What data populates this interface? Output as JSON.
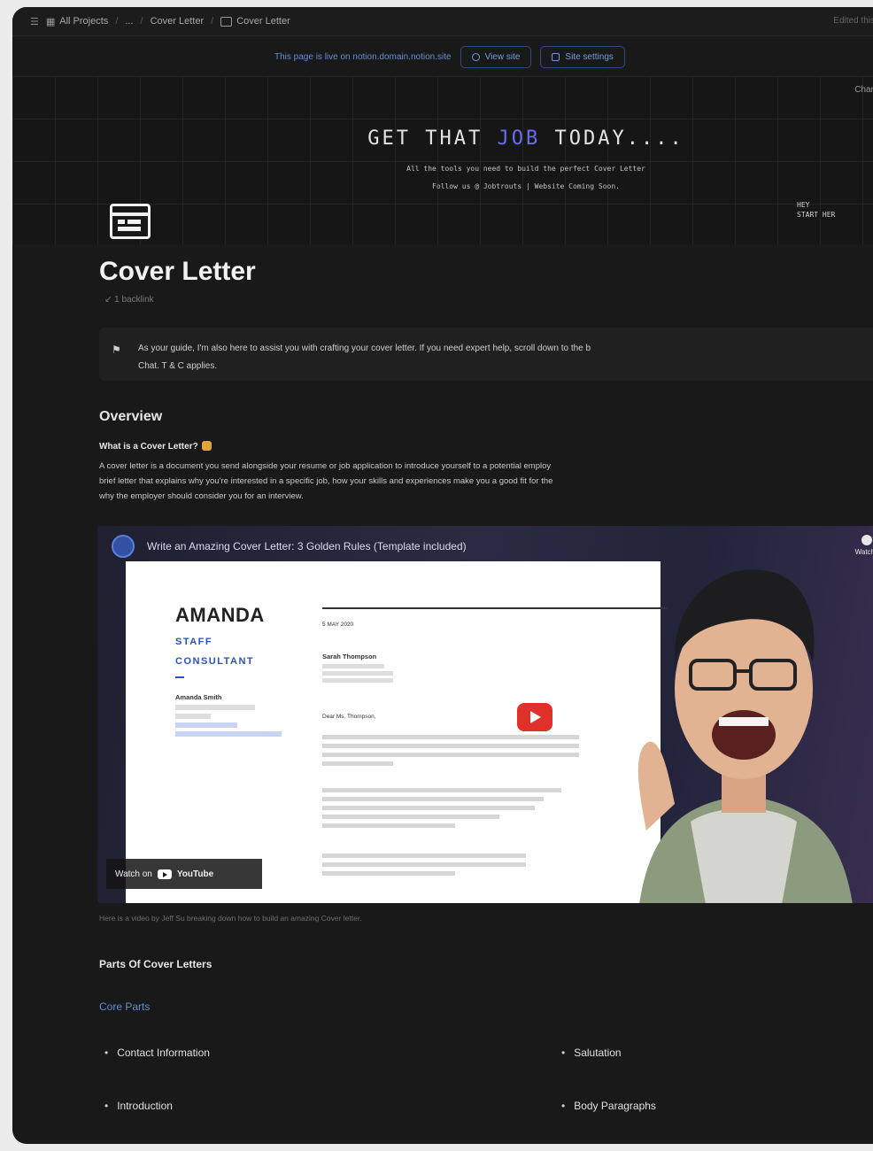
{
  "breadcrumbs": [
    "All Projects",
    "...",
    "Cover Letter",
    "Cover Letter"
  ],
  "edit_info": "Edited this w",
  "banner": {
    "note": "This page is live on notion.domain.notion.site",
    "view_site": "View site",
    "site_settings": "Site settings"
  },
  "cover": {
    "change_cover": "Change c",
    "headline_pre": "GET THAT ",
    "headline_highlight": "JOB",
    "headline_post": " TODAY....",
    "sub1": "All the tools you need to build the perfect Cover Letter",
    "sub2": "Follow us @ Jobtrouts | Website Coming Soon.",
    "start_line1": "HEY",
    "start_line2": "START HER"
  },
  "page": {
    "title": "Cover Letter",
    "backlinks": "↙ 1 backlink"
  },
  "callout": {
    "line1": "As your guide, I'm also here to assist you with crafting your cover letter. If you need expert help, scroll down to the b",
    "line2": "Chat. T & C applies."
  },
  "overview": {
    "heading": "Overview",
    "question": "What is a Cover Letter?",
    "para1": "A cover letter is a document you send alongside your resume or job application to introduce yourself to a potential employ",
    "para2": "brief letter that explains why you're interested in a specific job, how your skills and experiences make you a good fit for the",
    "para3": "why the employer should consider you for an interview."
  },
  "video": {
    "title": "Write an Amazing Cover Letter: 3 Golden Rules (Template included)",
    "watch_later": "Watch l",
    "watch_on": "Watch on",
    "youtube": "YouTube",
    "doc_name": "AMANDA",
    "doc_role1": "STAFF",
    "doc_role2": "CONSULTANT",
    "doc_contact_name": "Amanda Smith",
    "doc_date": "5 MAY 2020",
    "doc_recipient": "Sarah Thompson",
    "doc_greeting": "Dear Ms. Thompson,"
  },
  "caption": "Here is a video by Jeff Su breaking down how to build an amazing Cover letter.",
  "parts": {
    "heading": "Parts Of Cover Letters",
    "core_link": "Core Parts",
    "items": [
      "Contact Information",
      "Salutation",
      "Introduction",
      "Body Paragraphs"
    ]
  }
}
